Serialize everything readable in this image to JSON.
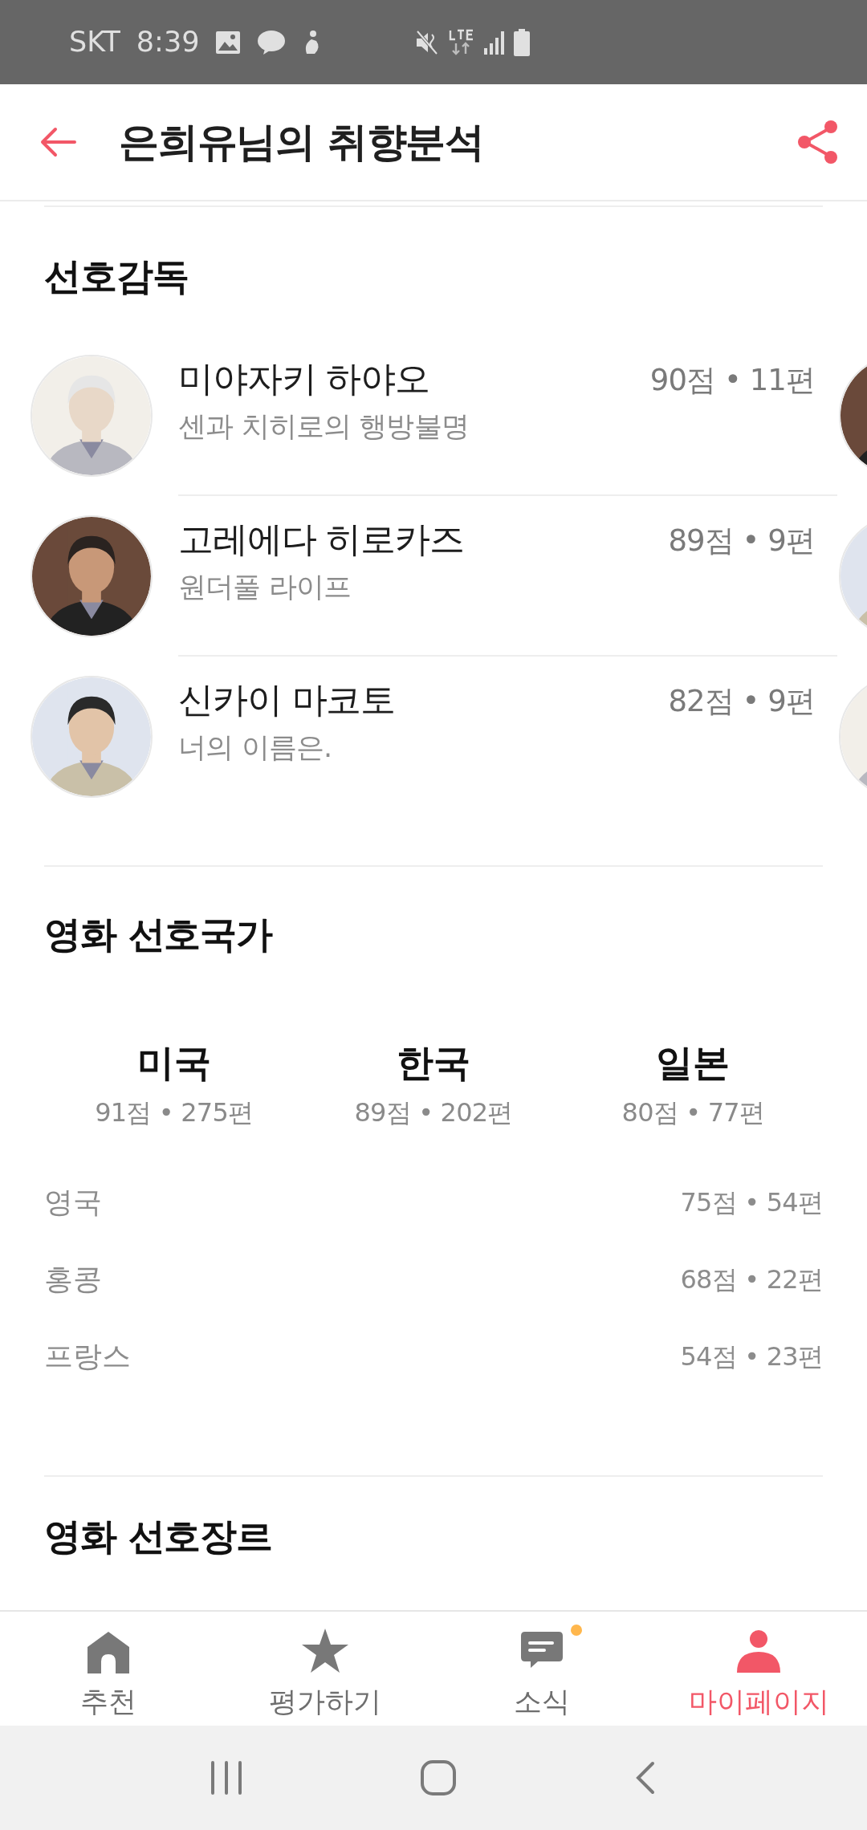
{
  "status_bar": {
    "carrier": "SKT",
    "time": "8:39"
  },
  "app_bar": {
    "title": "은희유님의 취향분석"
  },
  "directors": {
    "heading": "선호감독",
    "items": [
      {
        "name": "미야자키 하야오",
        "film": "센과 치히로의 행방불명",
        "stats": "90점 • 11편"
      },
      {
        "name": "고레에다 히로카즈",
        "film": "원더풀 라이프",
        "stats": "89점 • 9편"
      },
      {
        "name": "신카이 마코토",
        "film": "너의 이름은.",
        "stats": "82점 • 9편"
      }
    ]
  },
  "countries": {
    "heading": "영화 선호국가",
    "top": [
      {
        "name": "미국",
        "stats": "91점 • 275편"
      },
      {
        "name": "한국",
        "stats": "89점 • 202편"
      },
      {
        "name": "일본",
        "stats": "80점 • 77편"
      }
    ],
    "others": [
      {
        "name": "영국",
        "stats": "75점 • 54편"
      },
      {
        "name": "홍콩",
        "stats": "68점 • 22편"
      },
      {
        "name": "프랑스",
        "stats": "54점 • 23편"
      }
    ]
  },
  "genres": {
    "heading": "영화 선호장르"
  },
  "bottom_nav": [
    {
      "label": "추천",
      "selected": false,
      "badge": false
    },
    {
      "label": "평가하기",
      "selected": false,
      "badge": false
    },
    {
      "label": "소식",
      "selected": false,
      "badge": true
    },
    {
      "label": "마이페이지",
      "selected": true,
      "badge": false
    }
  ]
}
